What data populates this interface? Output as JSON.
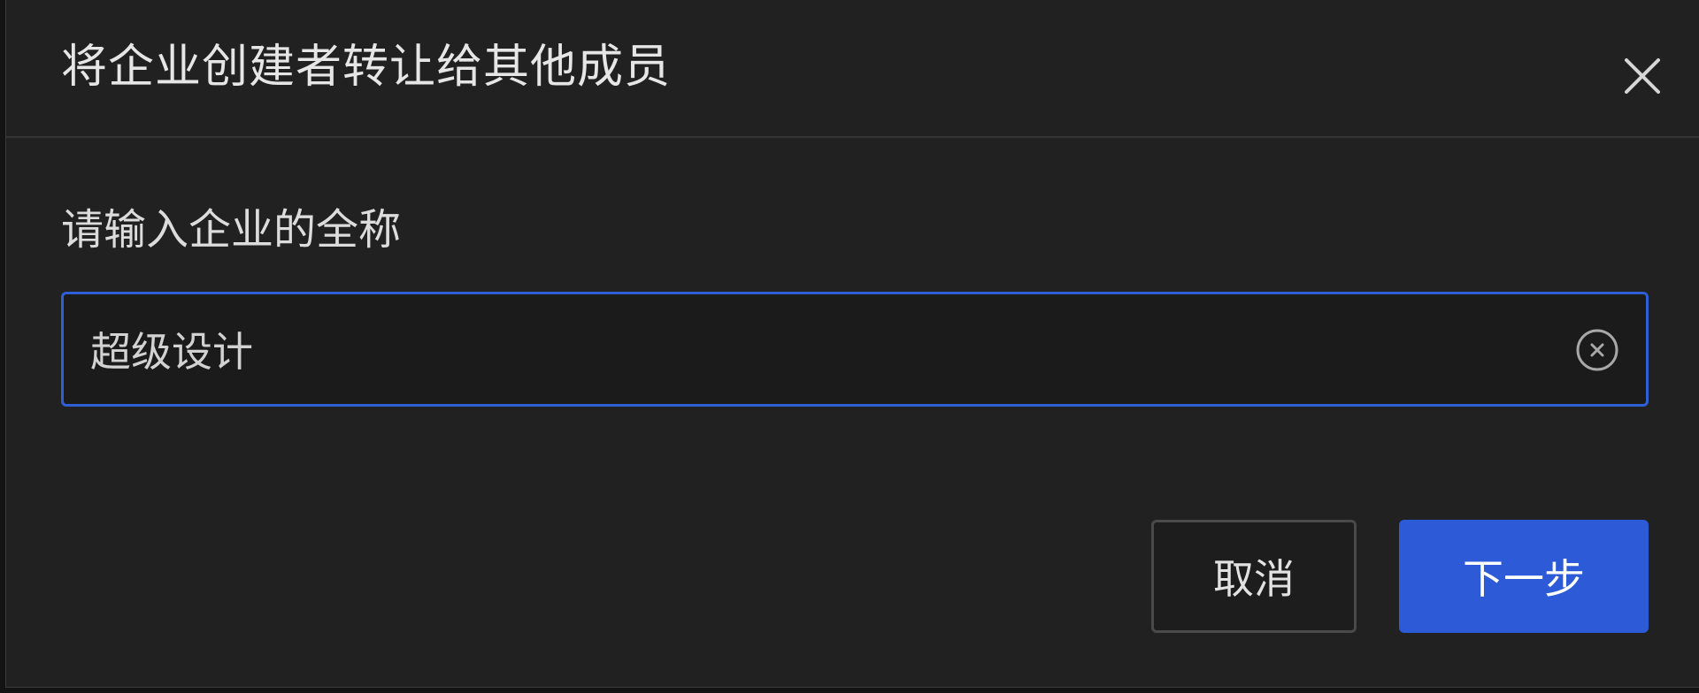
{
  "dialog": {
    "title": "将企业创建者转让给其他成员",
    "field_label": "请输入企业的全称",
    "input": {
      "value": "超级设计"
    },
    "buttons": {
      "cancel_label": "取消",
      "next_label": "下一步"
    }
  },
  "colors": {
    "accent": "#2d5bd7",
    "focus_border": "#2f5fd6",
    "dialog_bg": "#212121"
  },
  "icons": {
    "close": "close-icon",
    "clear": "clear-circle-icon"
  }
}
